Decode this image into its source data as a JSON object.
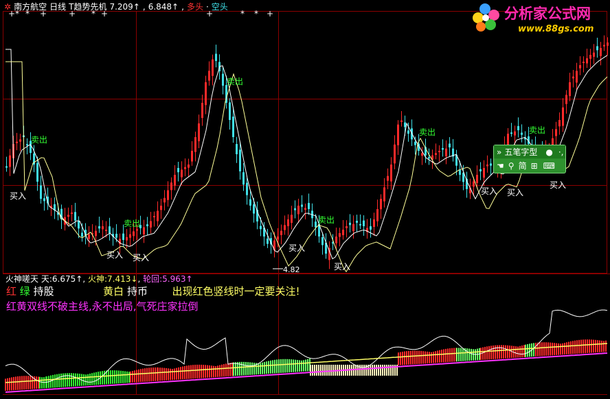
{
  "header": {
    "stock_name": "南方航空",
    "period": "日线",
    "indicator_name": "T趋势先机",
    "value1": "7.209↑",
    "value2": "6.848↑",
    "bull_label": "多头",
    "bear_label": "空头"
  },
  "logo": {
    "site_name": "分析家公式网",
    "url": "www.88gs.com"
  },
  "main_chart": {
    "buy_label": "买入",
    "sell_label": "卖出",
    "low_price": "4.82"
  },
  "ime": {
    "title": "五笔字型",
    "mode": "简"
  },
  "sub_panel": {
    "indicator_name": "火神嗟天",
    "tian_label": "天:",
    "tian_value": "6.675↑",
    "huoshen_label": "火神:",
    "huoshen_value": "7.413↓",
    "lunhui_label": "轮回:",
    "lunhui_value": "5.963↑",
    "note1_red": "红",
    "note1_green": "绿",
    "note1_hold": "持股",
    "note1_yellow_white": "黄白",
    "note1_coin": "持币",
    "note1_warning": "出现红色竖线时一定要关注!",
    "note2_part1": "红黄双线不破主线,永不出局,",
    "note2_part2": "气死庄家拉倒"
  },
  "colors": {
    "up": "#ff2a2a",
    "down": "#40e0e8",
    "ma": "#ffffff",
    "ma2": "#ffff99",
    "grid": "#8b0000",
    "label_green": "#33ff33",
    "note_magenta": "#ff33ff"
  }
}
